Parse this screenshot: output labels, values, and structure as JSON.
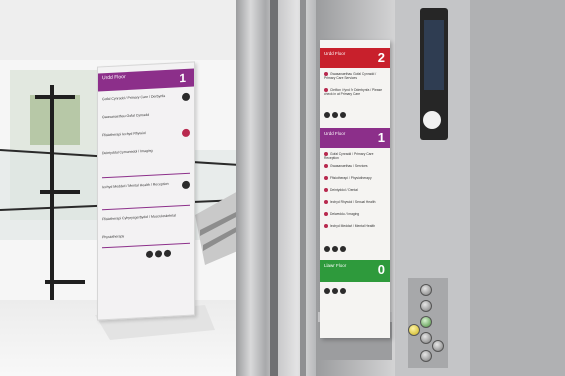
{
  "totem_sign": {
    "header": {
      "level_label": "Urdd Floor",
      "level_number": "1"
    },
    "entries": [
      {
        "text": "Gofal Cynradd / Primary Care / Derbynfa"
      },
      {
        "text": "Gwasanaethau Gofal Cynradd"
      },
      {
        "text": "Ffisiotherapi Iechyd Rhywiol"
      },
      {
        "text": "Deintyddol Cymunedol / Imaging"
      },
      {
        "text": "Iechyd Meddwl / Mental Health / Reception"
      },
      {
        "text": "Ffisiotherapi Cyhyrysgerbydol / Musculoskeletal"
      },
      {
        "text": "Physiotherapy"
      }
    ]
  },
  "wall_sign": {
    "top": {
      "level_label": "Urdd Floor",
      "level_number": "2"
    },
    "mid": {
      "level_label": "Urdd Floor",
      "level_number": "1"
    },
    "bottom": {
      "level_label": "Llawr Floor",
      "level_number": "0"
    },
    "top_entries": [
      {
        "text": "Gwasanaethau Gofal Cynradd / Primary Care Services"
      },
      {
        "text": "Cleifion i fynd i'r Dderbynfa / Please check in at Primary Care"
      }
    ],
    "mid_entries": [
      {
        "text": "Gofal Cynradd / Primary Care Reception"
      },
      {
        "text": "Gwasanaethau / Services"
      },
      {
        "text": "Ffisiotherapi / Physiotherapy"
      },
      {
        "text": "Deintyddol / Dental"
      },
      {
        "text": "Iechyd Rhywiol / Sexual Health"
      },
      {
        "text": "Delweddu / Imaging"
      },
      {
        "text": "Iechyd Meddwl / Mental Health"
      }
    ]
  },
  "colors": {
    "purple": "#8c2f8a",
    "red": "#c8202c",
    "green": "#2e9a3c",
    "steel": "#b9b9bb"
  },
  "icons": [
    "arrow-right-icon",
    "wheelchair-icon",
    "lift-call-button-icon"
  ]
}
